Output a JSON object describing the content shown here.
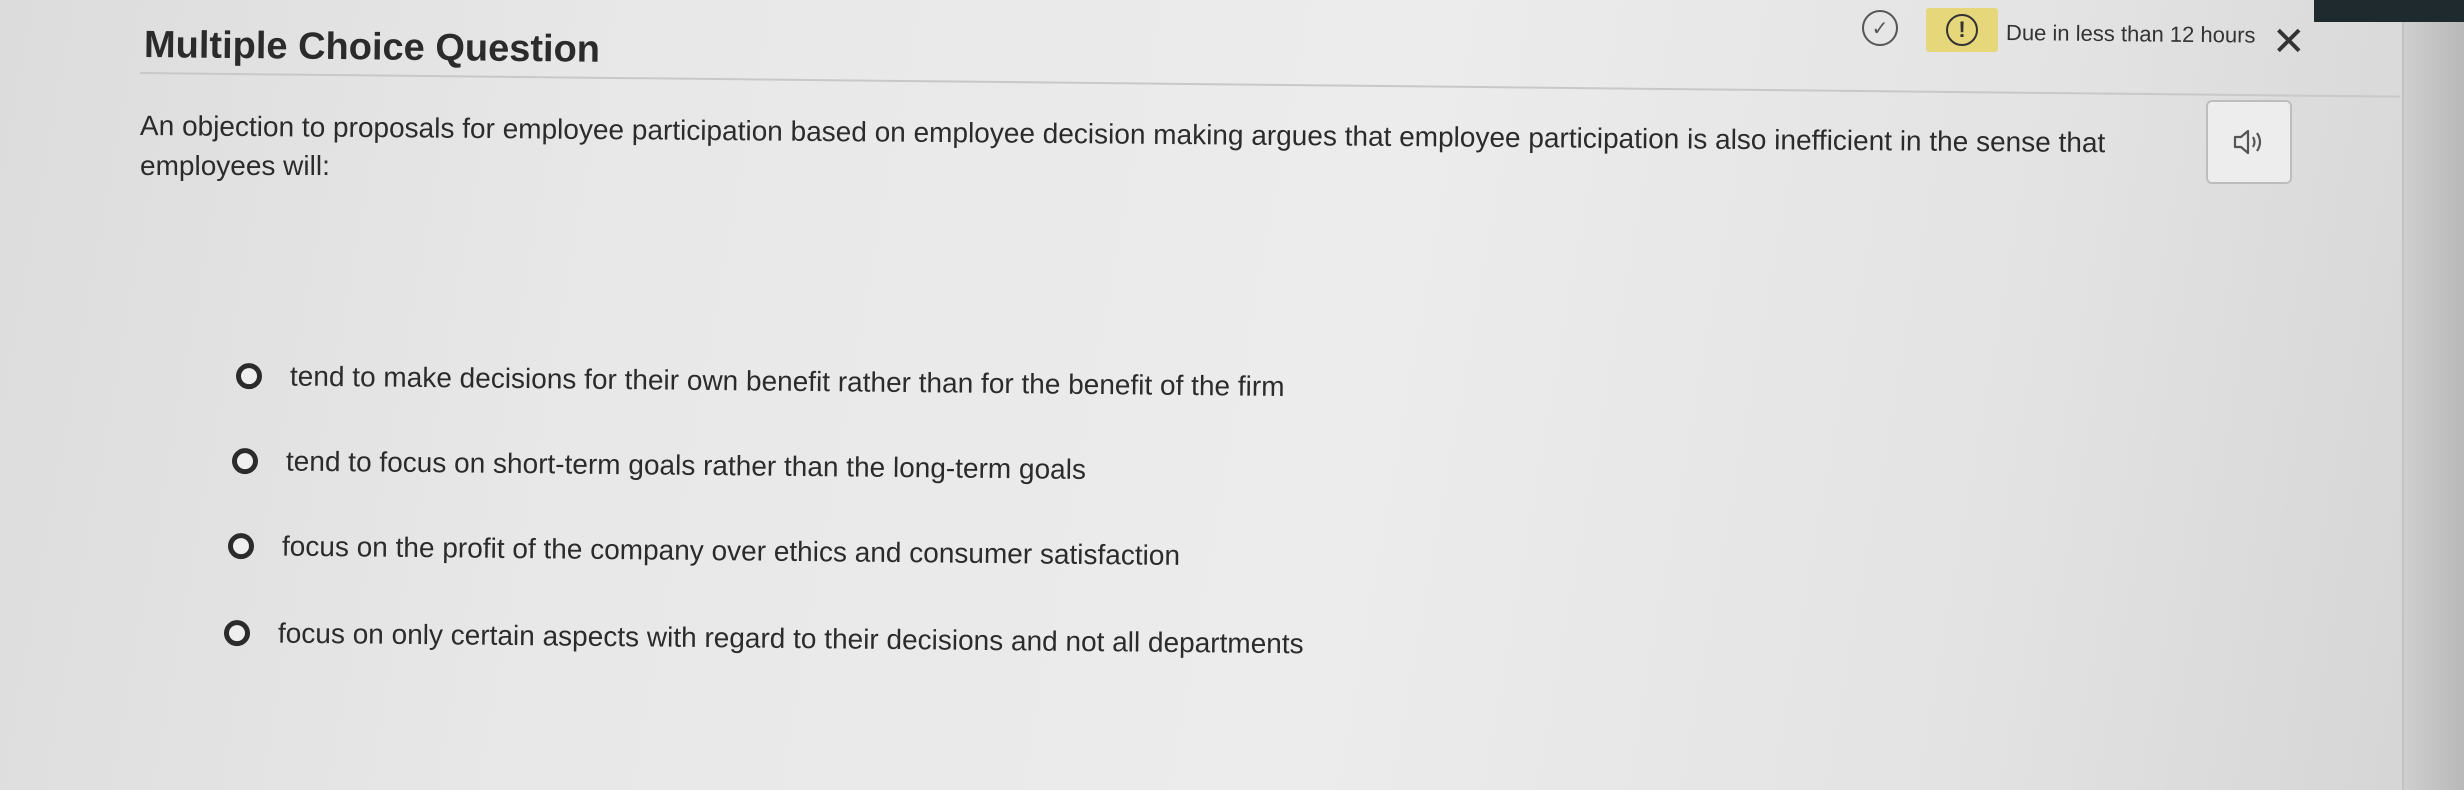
{
  "header": {
    "title": "Multiple Choice Question",
    "due_text": "Due in less than 12 hours",
    "check_icon": "check-circle-icon",
    "warning_icon": "exclamation-circle-icon",
    "close_icon": "close-icon",
    "due_badge_color": "#e6d87a"
  },
  "question": {
    "line1": "An objection to proposals for employee participation based on employee decision making argues that employee participation is also inefficient in the sense that",
    "line2": "employees will:",
    "audio_icon": "speaker-icon"
  },
  "options": [
    {
      "label": "tend to make decisions for their own benefit rather than for the benefit of the firm"
    },
    {
      "label": "tend to focus on short-term goals rather than the long-term goals"
    },
    {
      "label": "focus on the profit of the company over ethics and consumer satisfaction"
    },
    {
      "label": "focus on only certain aspects with regard to their decisions and not all departments"
    }
  ]
}
